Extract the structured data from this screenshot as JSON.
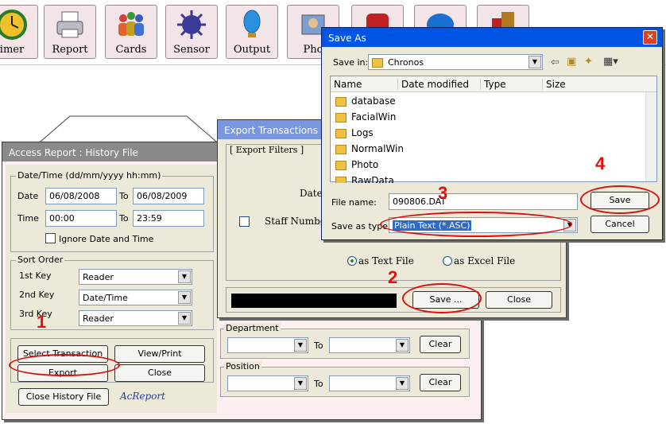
{
  "toolbar": {
    "buttons": [
      {
        "label": "imer",
        "icon": "clock-icon"
      },
      {
        "label": "Report",
        "icon": "printer-icon"
      },
      {
        "label": "Cards",
        "icon": "people-icon"
      },
      {
        "label": "Sensor",
        "icon": "sensor-icon"
      },
      {
        "label": "Output",
        "icon": "bulb-icon"
      },
      {
        "label": "Pho",
        "icon": "photo-icon"
      },
      {
        "label": "",
        "icon": "alarm-icon"
      },
      {
        "label": "",
        "icon": "globe-icon"
      },
      {
        "label": "",
        "icon": "exit-icon"
      }
    ]
  },
  "access_report": {
    "title": "Access Report : History File",
    "datetime_group": "Date/Time  (dd/mm/yyyy  hh:mm)",
    "date_label": "Date",
    "date_from": "06/08/2008",
    "to_label": "To",
    "date_to": "06/08/2009",
    "time_label": "Time",
    "time_from": "00:00",
    "time_to": "23:59",
    "ignore_label": "Ignore Date and Time",
    "sort_group": "Sort Order",
    "key1_label": "1st Key",
    "key1_value": "Reader",
    "key2_label": "2nd Key",
    "key2_value": "Date/Time",
    "key3_label": "3rd Key",
    "key3_value": "Reader",
    "select_btn": "Select Transaction",
    "view_btn": "View/Print",
    "export_btn": "Export",
    "close_btn": "Close",
    "close_history_btn": "Close History File",
    "acreport": "AcReport",
    "department_label": "Department",
    "position_label": "Position",
    "clear_label": "Clear"
  },
  "export_tx": {
    "title": "Export Transactions",
    "filters_label": "[ Export Filters ]",
    "date_label": "Date",
    "staff_label": "Staff Number",
    "text_file": "as Text File",
    "excel_file": "as Excel File",
    "save_btn": "Save ...",
    "close_btn": "Close"
  },
  "save_as": {
    "title": "Save As",
    "save_in_label": "Save in:",
    "save_in_value": "Chronos",
    "columns": [
      "Name",
      "Date modified",
      "Type",
      "Size"
    ],
    "folders": [
      "database",
      "FacialWin",
      "Logs",
      "NormalWin",
      "Photo",
      "RawData"
    ],
    "filename_label": "File name:",
    "filename_value": "090806.DAT",
    "saveas_label": "Save as type:",
    "saveas_value": "Plain Text (*.ASC)",
    "save_btn": "Save",
    "cancel_btn": "Cancel"
  },
  "steps": [
    "1",
    "2",
    "3",
    "4"
  ],
  "colors": {
    "title_active": "#0054e3",
    "title_inactive": "#7a96df",
    "dialog_bg": "#ece9d8",
    "window_bg": "#fdeef0",
    "annotation_red": "#d81010"
  }
}
